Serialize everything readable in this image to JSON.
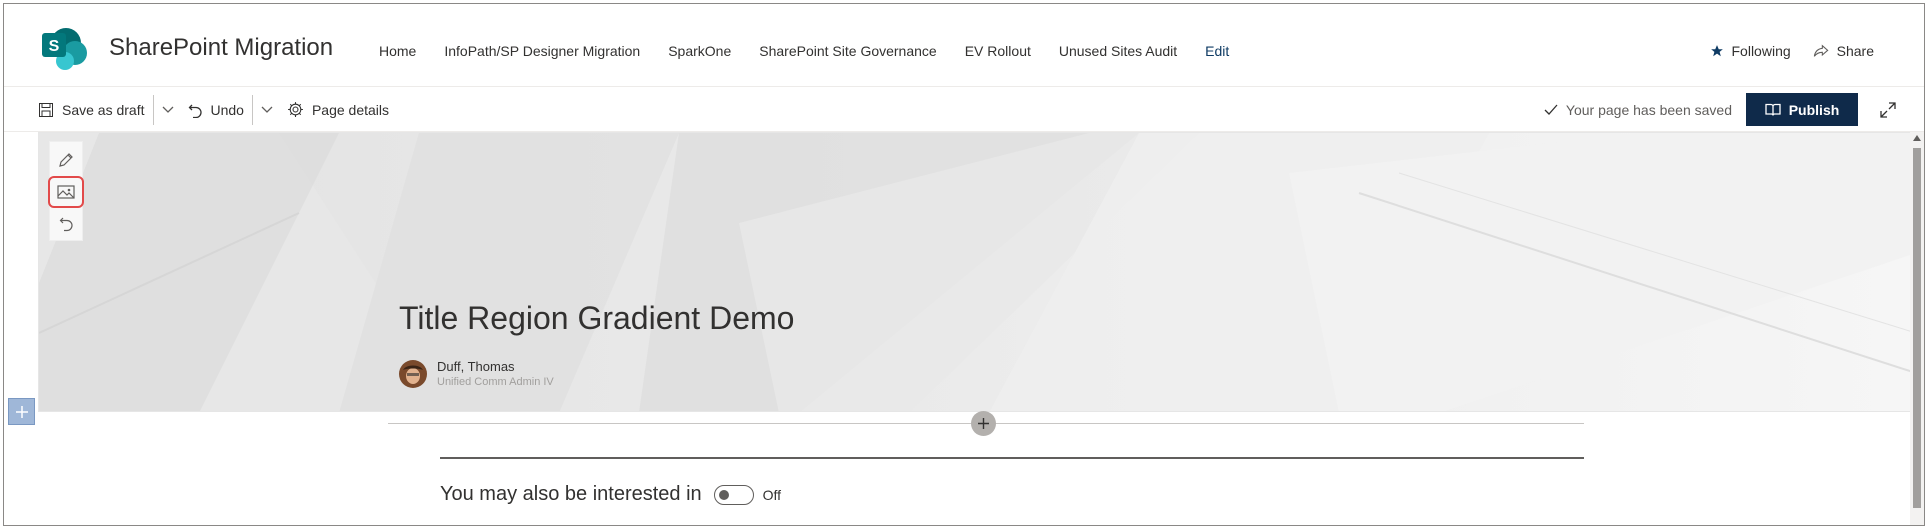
{
  "header": {
    "logo_letter": "S",
    "site_title": "SharePoint Migration",
    "nav": [
      "Home",
      "InfoPath/SP Designer Migration",
      "SparkOne",
      "SharePoint Site Governance",
      "EV Rollout",
      "Unused Sites Audit",
      "Edit"
    ],
    "following_label": "Following",
    "share_label": "Share"
  },
  "commandbar": {
    "save_draft_label": "Save as draft",
    "undo_label": "Undo",
    "page_details_label": "Page details",
    "saved_status": "Your page has been saved",
    "publish_label": "Publish"
  },
  "title_region": {
    "title": "Title Region Gradient Demo",
    "author_name": "Duff, Thomas",
    "author_role": "Unified Comm Admin IV"
  },
  "body": {
    "also_interested_label": "You may also be interested in",
    "toggle_state_label": "Off"
  },
  "colors": {
    "publish_bg": "#0f2a4a",
    "logo_teal": "#038387",
    "highlight_outline": "#e24a4a"
  }
}
